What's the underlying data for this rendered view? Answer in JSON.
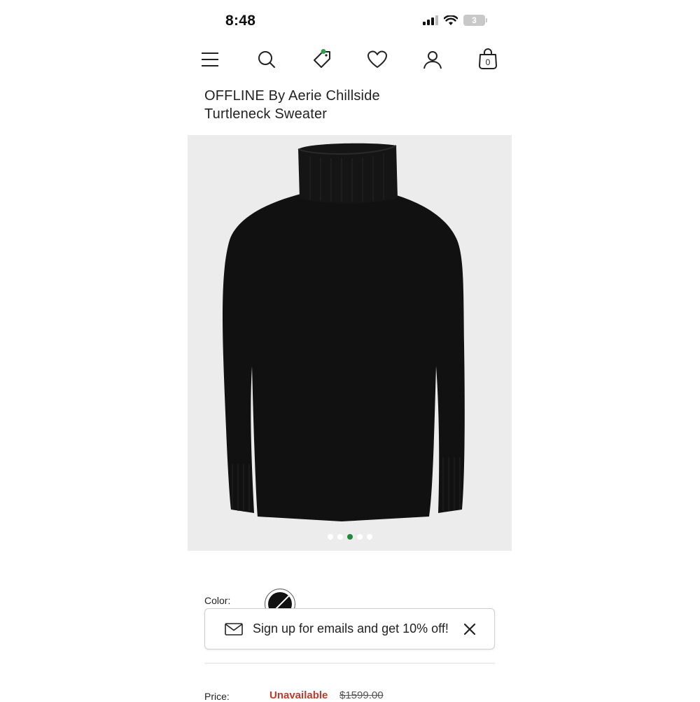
{
  "status_bar": {
    "time": "8:48",
    "battery_level": "3"
  },
  "nav": {
    "icons": [
      "menu-icon",
      "search-icon",
      "offers-tag-icon",
      "wishlist-heart-icon",
      "account-icon",
      "bag-icon"
    ],
    "bag_count": "0",
    "offers_dot_color": "#2e9e4f"
  },
  "product": {
    "title": "OFFLINE By Aerie Chillside Turtleneck Sweater",
    "image_background": "#ececec",
    "gallery": {
      "count": 5,
      "active_index": 2,
      "active_color": "#1f8a3c"
    },
    "color_label": "Color:",
    "price_label": "Price:",
    "price_status": "Unavailable",
    "original_price": "$1599.00"
  },
  "email_banner": {
    "text": "Sign up for emails and get 10% off!"
  },
  "colors": {
    "sale_red": "#c0392b",
    "accent_green": "#1f8a3c"
  }
}
